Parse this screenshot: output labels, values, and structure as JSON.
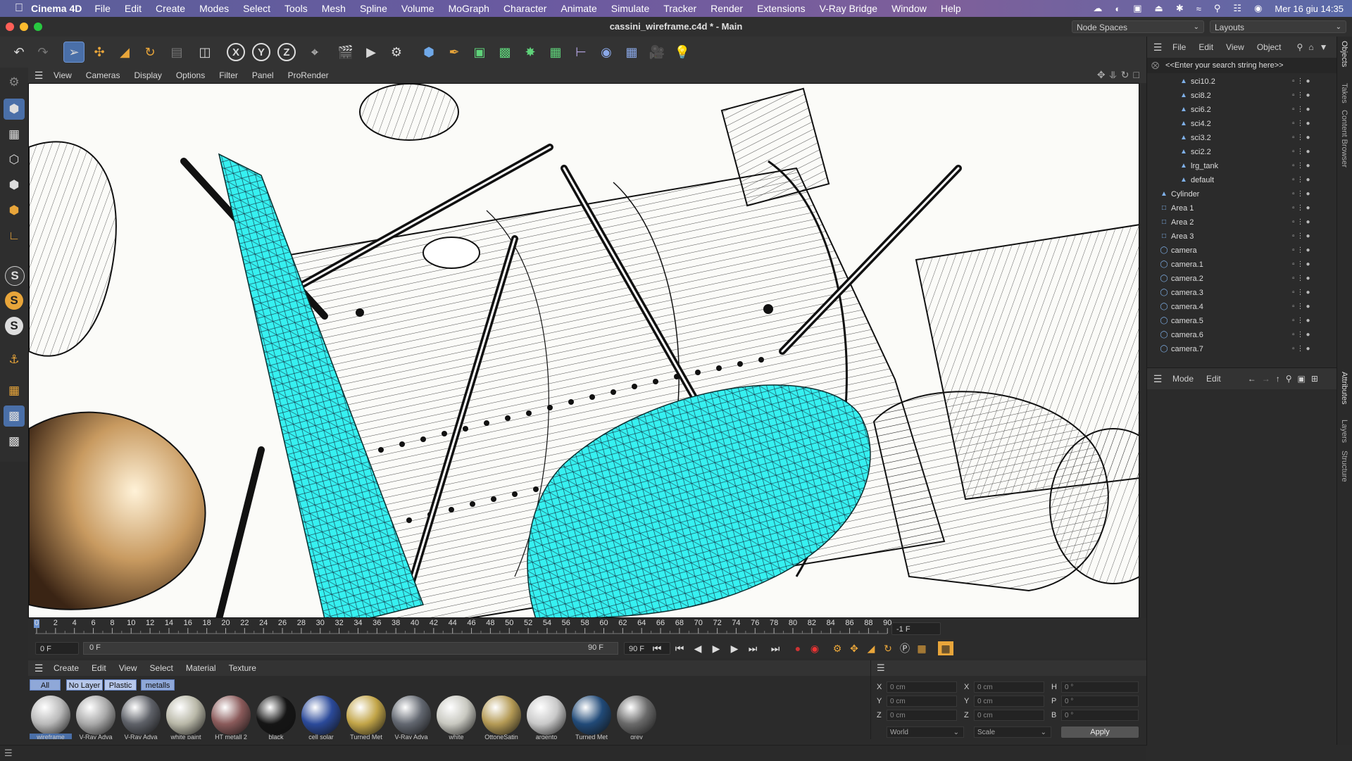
{
  "menubar": {
    "app_name": "Cinema 4D",
    "items": [
      "File",
      "Edit",
      "Create",
      "Modes",
      "Select",
      "Tools",
      "Mesh",
      "Spline",
      "Volume",
      "MoGraph",
      "Character",
      "Animate",
      "Simulate",
      "Tracker",
      "Render",
      "Extensions",
      "V-Ray Bridge",
      "Window",
      "Help"
    ],
    "clock": "Mer 16 giu  14:35"
  },
  "window": {
    "title": "cassini_wireframe.c4d * - Main",
    "node_spaces": "Node Spaces",
    "layouts": "Layouts"
  },
  "viewport": {
    "menu": [
      "View",
      "Cameras",
      "Display",
      "Options",
      "Filter",
      "Panel",
      "ProRender"
    ]
  },
  "timeline": {
    "ticks": [
      "0",
      "2",
      "4",
      "6",
      "8",
      "10",
      "12",
      "14",
      "16",
      "18",
      "20",
      "22",
      "24",
      "26",
      "28",
      "30",
      "32",
      "34",
      "36",
      "38",
      "40",
      "42",
      "44",
      "46",
      "48",
      "50",
      "52",
      "54",
      "56",
      "58",
      "60",
      "62",
      "64",
      "66",
      "68",
      "70",
      "72",
      "74",
      "76",
      "78",
      "80",
      "82",
      "84",
      "86",
      "88",
      "90"
    ],
    "current_frame_field": "-1 F",
    "start_frame": "0 F",
    "preview_start": "0 F",
    "preview_end": "90 F",
    "end_frame": "90 F"
  },
  "materials": {
    "menu": [
      "Create",
      "Edit",
      "View",
      "Select",
      "Material",
      "Texture"
    ],
    "tabs": [
      "All",
      "No Layer",
      "Plastic",
      "metalls"
    ],
    "items": [
      {
        "label": "wireframe",
        "color": "#b9b9b9"
      },
      {
        "label": "V-Ray Adva",
        "color": "#a9a9a9"
      },
      {
        "label": "V-Ray Adva",
        "color": "#5e6168"
      },
      {
        "label": "white paint",
        "color": "#b9b8a8"
      },
      {
        "label": "HT metall 2",
        "color": "#8a5a5a"
      },
      {
        "label": "black",
        "color": "#151515"
      },
      {
        "label": "cell solar",
        "color": "#2b4a9a"
      },
      {
        "label": "Turned Met",
        "color": "#c2a548"
      },
      {
        "label": "V-Ray Adva",
        "color": "#626770"
      },
      {
        "label": "white",
        "color": "#c8c8c0"
      },
      {
        "label": "OttoneSatin",
        "color": "#b49a55"
      },
      {
        "label": "argento",
        "color": "#c9c9c9"
      },
      {
        "label": "Turned Met",
        "color": "#214a78"
      },
      {
        "label": "grey",
        "color": "#6a6a6a"
      }
    ]
  },
  "coordinates": {
    "pos_labels": [
      "X",
      "Y",
      "Z"
    ],
    "pos_values": [
      "0 cm",
      "0 cm",
      "0 cm"
    ],
    "size_labels": [
      "X",
      "Y",
      "Z"
    ],
    "size_values": [
      "0 cm",
      "0 cm",
      "0 cm"
    ],
    "rot_labels": [
      "H",
      "P",
      "B"
    ],
    "rot_values": [
      "0 °",
      "0 °",
      "0 °"
    ],
    "mode_world": "World",
    "mode_scale": "Scale",
    "apply": "Apply"
  },
  "objects": {
    "menu": [
      "File",
      "Edit",
      "View",
      "Object"
    ],
    "search_placeholder": "<<Enter your search string here>>",
    "rows": [
      {
        "name": "sci10.2",
        "indent": 2
      },
      {
        "name": "sci8.2",
        "indent": 2
      },
      {
        "name": "sci6.2",
        "indent": 2
      },
      {
        "name": "sci4.2",
        "indent": 2
      },
      {
        "name": "sci3.2",
        "indent": 2
      },
      {
        "name": "sci2.2",
        "indent": 2
      },
      {
        "name": "lrg_tank",
        "indent": 2
      },
      {
        "name": "default",
        "indent": 2
      },
      {
        "name": "Cylinder",
        "indent": 0
      },
      {
        "name": "Area 1",
        "indent": 0
      },
      {
        "name": "Area 2",
        "indent": 0
      },
      {
        "name": "Area 3",
        "indent": 0
      },
      {
        "name": "camera",
        "indent": 0
      },
      {
        "name": "camera.1",
        "indent": 0
      },
      {
        "name": "camera.2",
        "indent": 0
      },
      {
        "name": "camera.3",
        "indent": 0
      },
      {
        "name": "camera.4",
        "indent": 0
      },
      {
        "name": "camera.5",
        "indent": 0
      },
      {
        "name": "camera.6",
        "indent": 0
      },
      {
        "name": "camera.7",
        "indent": 0
      }
    ]
  },
  "attributes": {
    "menu": [
      "Mode",
      "Edit"
    ]
  },
  "side_tabs": [
    "Objects",
    "Takes",
    "Content Browser",
    "Attributes",
    "Layers",
    "Structure"
  ],
  "colors": {
    "selection_cyan": "#36f0f0",
    "accent_blue": "#4a6fa8"
  }
}
